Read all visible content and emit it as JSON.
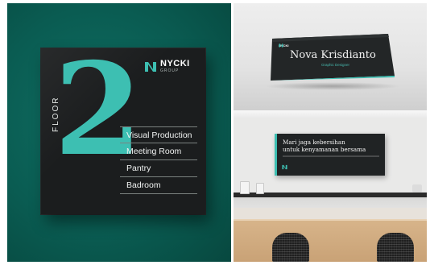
{
  "floor_sign": {
    "number": "2",
    "floor_label": "FLOOR",
    "brand": {
      "name": "NYCKI",
      "sub": "GROUP"
    },
    "rooms": [
      "Visual Production",
      "Meeting Room",
      "Pantry",
      "Badroom"
    ],
    "accent_color": "#3dbfb2"
  },
  "nameplate": {
    "brand": "NYCKI",
    "name": "Nova Krisdianto",
    "role": "Graphic Designer"
  },
  "wall_sign": {
    "line1": "Mari jaga kebersihan",
    "line2": "untuk kenyamanan bersama"
  },
  "colors": {
    "wall_teal": "#0a5c52",
    "sign_dark": "#1b1d1e",
    "accent": "#3dbfb2"
  }
}
